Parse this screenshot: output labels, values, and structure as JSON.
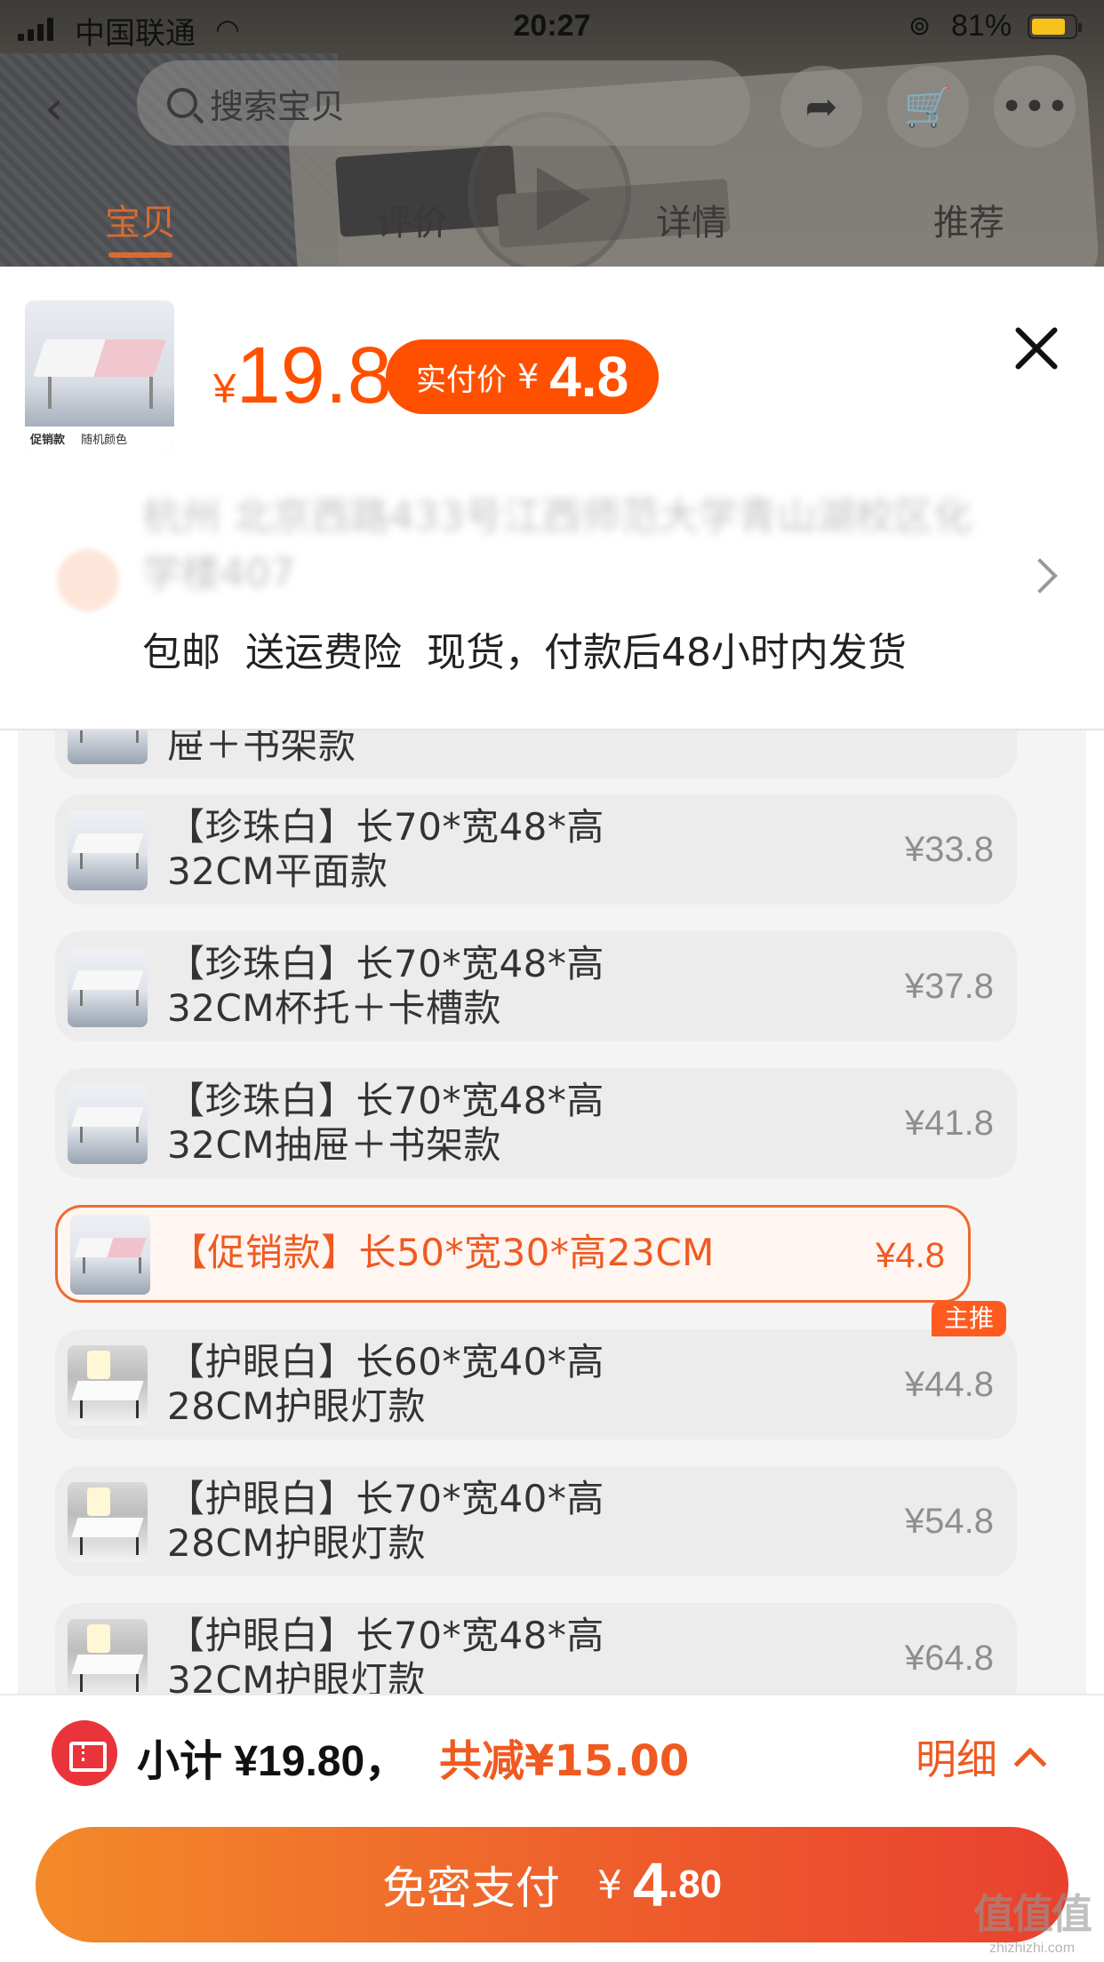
{
  "status_bar": {
    "carrier": "中国联通",
    "time": "20:27",
    "battery_percent": "81%",
    "battery_level": 0.81
  },
  "nav": {
    "search_placeholder": "搜索宝贝",
    "back_icon": "back-arrow-icon",
    "share_icon": "share-icon",
    "cart_icon": "cart-icon",
    "more_icon": "more-icon"
  },
  "tabs": [
    {
      "label": "宝贝",
      "active": true
    },
    {
      "label": "评价"
    },
    {
      "label": "详情"
    },
    {
      "label": "推荐"
    }
  ],
  "sheet": {
    "thumb_tag_left": "促销款",
    "thumb_tag_right": "随机颜色",
    "price_currency": "¥",
    "price": "19.8",
    "pay_label": "实付价",
    "pay_currency": "¥",
    "pay_amount": "4.8",
    "address": "杭州 北京西路433号江西师范大学青山湖校区化学楼407",
    "shipping": "包邮  送运费险  现货，付款后48小时内发货"
  },
  "variants": {
    "partial_top": {
      "label": "屉＋书架款"
    },
    "items": [
      {
        "label": "【珍珠白】长70*宽48*高32CM平面款",
        "price": "¥33.8"
      },
      {
        "label": "【珍珠白】长70*宽48*高32CM杯托＋卡槽款",
        "price": "¥37.8"
      },
      {
        "label": "【珍珠白】长70*宽48*高32CM抽屉＋书架款",
        "price": "¥41.8"
      },
      {
        "label": "【促销款】长50*宽30*高23CM",
        "price": "¥4.8",
        "selected": true
      },
      {
        "label": "【护眼白】长60*宽40*高28CM护眼灯款",
        "price": "¥44.8",
        "badge": "主推"
      },
      {
        "label": "【护眼白】长70*宽40*高28CM护眼灯款",
        "price": "¥54.8"
      },
      {
        "label": "【护眼白】长70*宽48*高32CM护眼灯款",
        "price": "¥64.8"
      }
    ]
  },
  "footer": {
    "subtotal_label": "小计",
    "subtotal_value": "¥19.80，",
    "saving_label": "共减",
    "saving_value": "¥15.00",
    "detail_label": "明细",
    "pay_button_label": "免密支付",
    "pay_currency": "¥",
    "pay_integer": "4",
    "pay_decimal": ".80"
  },
  "watermark": {
    "logo": "值值值",
    "site": "zhizhizhi.com"
  },
  "colors": {
    "accent": "#ff5000",
    "selected_border": "#ef6a2f",
    "coupon_red": "#e9343b"
  }
}
